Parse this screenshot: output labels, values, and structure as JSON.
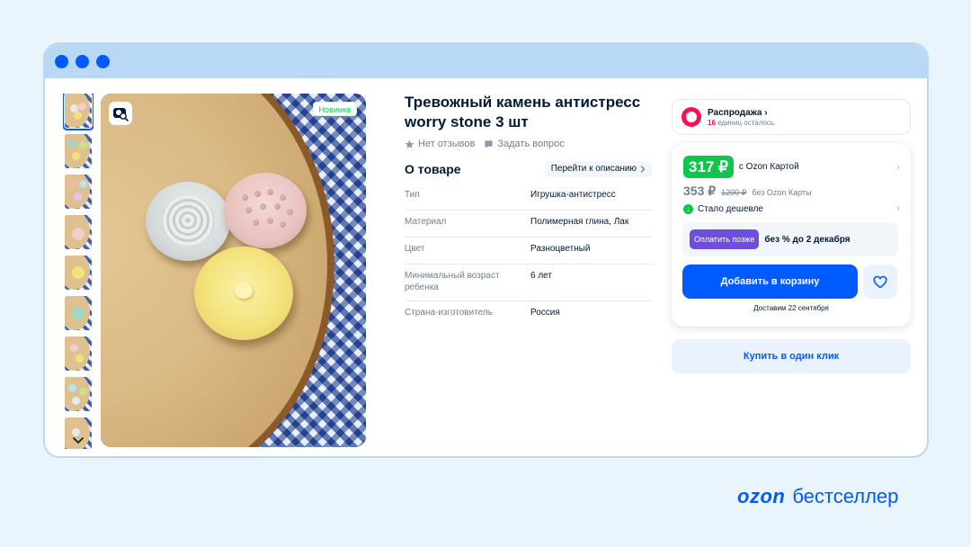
{
  "product": {
    "title": "Тревожный камень антистресс worry stone 3 шт",
    "badge_new": "Новинка",
    "reviews": "Нет отзывов",
    "ask_question": "Задать вопрос"
  },
  "about": {
    "title": "О товаре",
    "go_to_description": "Перейти к описанию",
    "specs": [
      {
        "key": "Тип",
        "value": "Игрушка-антистресс"
      },
      {
        "key": "Материал",
        "value": "Полимерная глина, Лак"
      },
      {
        "key": "Цвет",
        "value": "Разноцветный"
      },
      {
        "key": "Минимальный возраст ребенка",
        "value": "6 лет"
      },
      {
        "key": "Страна-изготовитель",
        "value": "Россия"
      }
    ]
  },
  "sale": {
    "name": "Распродажа",
    "count": "16",
    "remaining": "единиц осталось"
  },
  "pricing": {
    "card_price": "317 ₽",
    "card_label": "с Ozon Картой",
    "regular_price": "353 ₽",
    "old_price": "1200 ₽",
    "no_card_label": "без Ozon Карты",
    "cheaper": "Стало дешевле",
    "pay_later_button": "Оплатить позже",
    "pay_later_text": "без % до 2 декабря",
    "add_to_cart": "Добавить в корзину",
    "delivery": "Доставим 22 сентября",
    "buy_one_click": "Купить в один клик"
  },
  "branding": {
    "logo": "ozon",
    "tagline": "бестселлер"
  },
  "colors": {
    "accent": "#005bff",
    "sale": "#f91155",
    "price_green": "#10c44c",
    "pay_later": "#6d4fdc"
  }
}
